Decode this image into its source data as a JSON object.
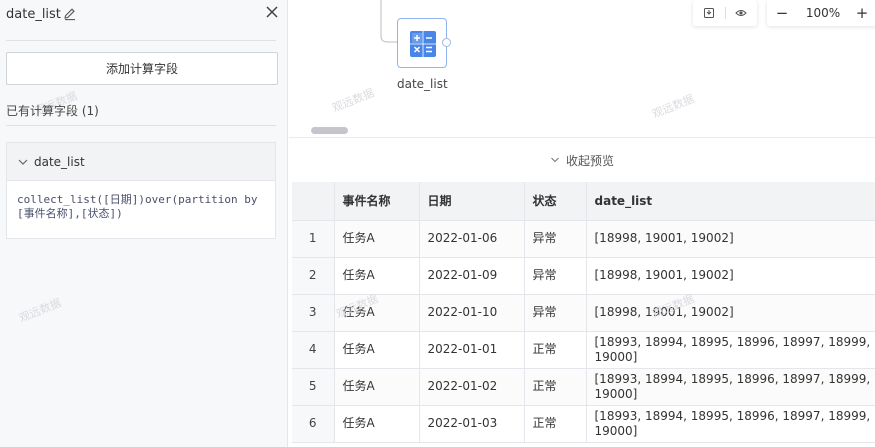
{
  "panel": {
    "title": "date_list",
    "add_button": "添加计算字段",
    "existing_label": "已有计算字段 (1)",
    "field": {
      "name": "date_list",
      "formula": "collect_list([日期])over(partition by [事件名称],[状态])"
    }
  },
  "canvas": {
    "node_label": "date_list",
    "zoom": "100%",
    "zoom_minus": "−",
    "zoom_plus": "+"
  },
  "watermark": "观远数据",
  "preview": {
    "collapse_label": "收起预览",
    "columns": [
      "",
      "事件名称",
      "日期",
      "状态",
      "date_list"
    ],
    "rows": [
      [
        "1",
        "任务A",
        "2022-01-06",
        "异常",
        "[18998, 19001, 19002]"
      ],
      [
        "2",
        "任务A",
        "2022-01-09",
        "异常",
        "[18998, 19001, 19002]"
      ],
      [
        "3",
        "任务A",
        "2022-01-10",
        "异常",
        "[18998, 19001, 19002]"
      ],
      [
        "4",
        "任务A",
        "2022-01-01",
        "正常",
        "[18993, 18994, 18995, 18996, 18997, 18999, 19000]"
      ],
      [
        "5",
        "任务A",
        "2022-01-02",
        "正常",
        "[18993, 18994, 18995, 18996, 18997, 18999, 19000]"
      ],
      [
        "6",
        "任务A",
        "2022-01-03",
        "正常",
        "[18993, 18994, 18995, 18996, 18997, 18999, 19000]"
      ]
    ]
  },
  "colors": {
    "node_blue": "#4a86e8",
    "border": "#e4e6eb"
  }
}
